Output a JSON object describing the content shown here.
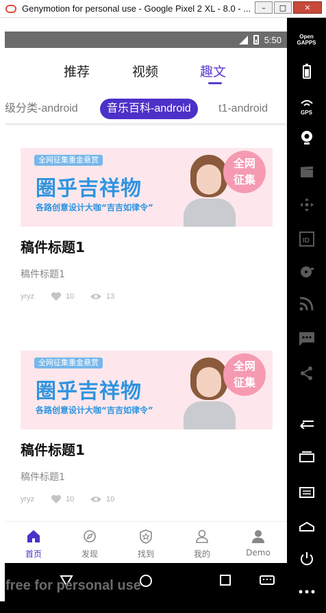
{
  "window": {
    "title": "Genymotion for personal use - Google Pixel 2 XL - 8.0 - ...",
    "minimize": "–",
    "maximize": "□",
    "close": "✕"
  },
  "status_bar": {
    "time": "5:50"
  },
  "top_tabs": [
    "推荐",
    "视频",
    "趣文"
  ],
  "active_tab": "趣文",
  "categories": [
    "级分类-android",
    "音乐百科-android",
    "t1-android"
  ],
  "active_category": "音乐百科-android",
  "banner": {
    "tag": "全网征集重金悬赏",
    "headline": "圈乎吉祥物",
    "sub": "各路创意设计大咖“吉吉如律令”",
    "bubble": "全网\n征集"
  },
  "articles": [
    {
      "title": "稿件标题1",
      "subtitle": "稿件标题1",
      "author": "yryz",
      "likes": "10",
      "views": "13"
    },
    {
      "title": "稿件标题1",
      "subtitle": "稿件标题1",
      "author": "yryz",
      "likes": "10",
      "views": "10"
    }
  ],
  "bottom_nav": [
    "首页",
    "发现",
    "找到",
    "我的",
    "Demo"
  ],
  "active_nav": "首页",
  "sidebar": {
    "gapps": "Open\nGAPPS",
    "gps": "GPS"
  },
  "watermark": "free for personal use",
  "colors": {
    "accent": "#4c31c8",
    "tab_active": "#5a3bd2",
    "banner_blue": "#2f94e0",
    "banner_bg": "#fde7ec"
  }
}
